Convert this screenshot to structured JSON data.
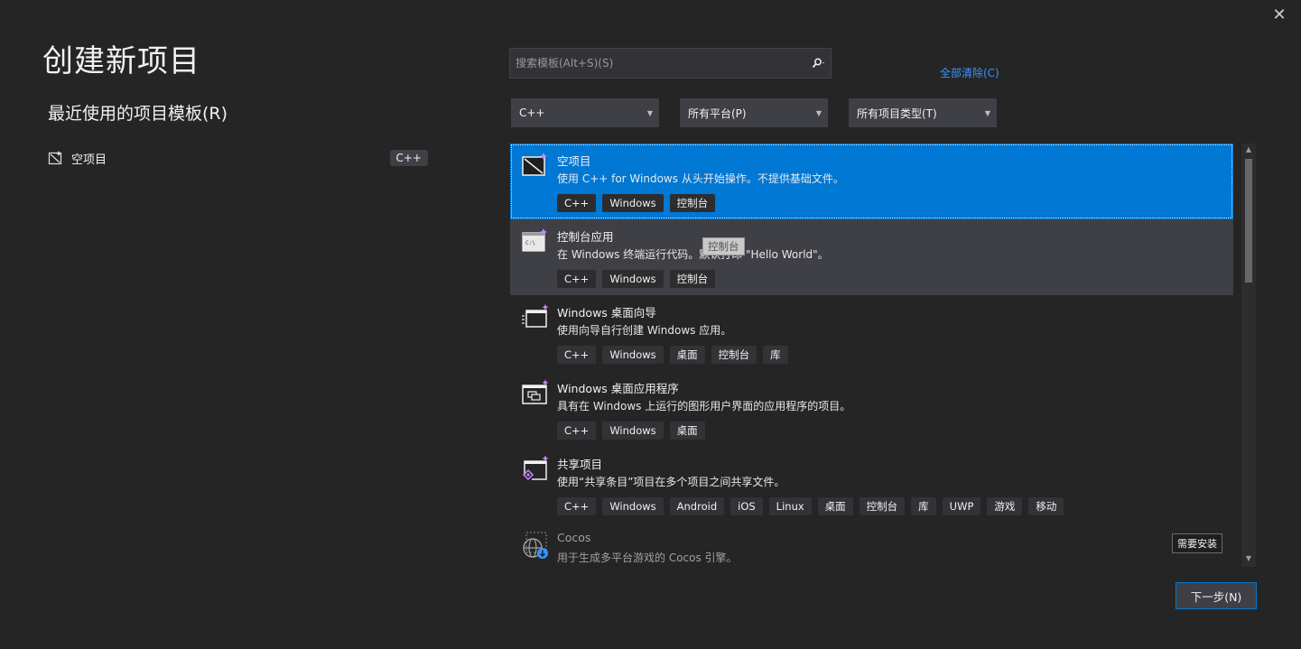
{
  "dialog": {
    "title": "创建新项目",
    "close_glyph": "✕"
  },
  "recent": {
    "title": "最近使用的项目模板(R)",
    "items": [
      {
        "label": "空项目",
        "tag": "C++",
        "icon": "empty-project-icon"
      }
    ]
  },
  "search": {
    "placeholder": "搜索模板(Alt+S)(S)",
    "value": "",
    "icon": "search-icon"
  },
  "clear_all": "全部清除(C)",
  "filters": {
    "language": "C++",
    "platform": "所有平台(P)",
    "project_type": "所有项目类型(T)"
  },
  "templates": [
    {
      "name": "空项目",
      "desc": "使用 C++ for Windows 从头开始操作。不提供基础文件。",
      "tags": [
        "C++",
        "Windows",
        "控制台"
      ],
      "state": "selected",
      "icon": "empty-project-icon"
    },
    {
      "name": "控制台应用",
      "desc": "在 Windows 终端运行代码。默认打印 \"Hello World\"。",
      "tags": [
        "C++",
        "Windows",
        "控制台"
      ],
      "state": "hover",
      "icon": "console-app-icon"
    },
    {
      "name": "Windows 桌面向导",
      "desc": "使用向导自行创建 Windows 应用。",
      "tags": [
        "C++",
        "Windows",
        "桌面",
        "控制台",
        "库"
      ],
      "state": "normal",
      "icon": "desktop-wizard-icon"
    },
    {
      "name": "Windows 桌面应用程序",
      "desc": "具有在 Windows 上运行的图形用户界面的应用程序的项目。",
      "tags": [
        "C++",
        "Windows",
        "桌面"
      ],
      "state": "normal",
      "icon": "desktop-app-icon"
    },
    {
      "name": "共享项目",
      "desc": "使用“共享条目”项目在多个项目之间共享文件。",
      "tags": [
        "C++",
        "Windows",
        "Android",
        "iOS",
        "Linux",
        "桌面",
        "控制台",
        "库",
        "UWP",
        "游戏",
        "移动"
      ],
      "state": "normal",
      "icon": "shared-project-icon"
    },
    {
      "name": "Cocos",
      "desc": "用于生成多平台游戏的 Cocos 引擎。",
      "tags": [],
      "state": "dim",
      "icon": "cocos-globe-icon",
      "badge": "需要安装"
    }
  ],
  "tooltip": "控制台",
  "next_button": "下一步(N)",
  "colors": {
    "background": "#252526",
    "selected": "#0078d4",
    "hover": "#3f3f46",
    "link": "#3794ff"
  }
}
